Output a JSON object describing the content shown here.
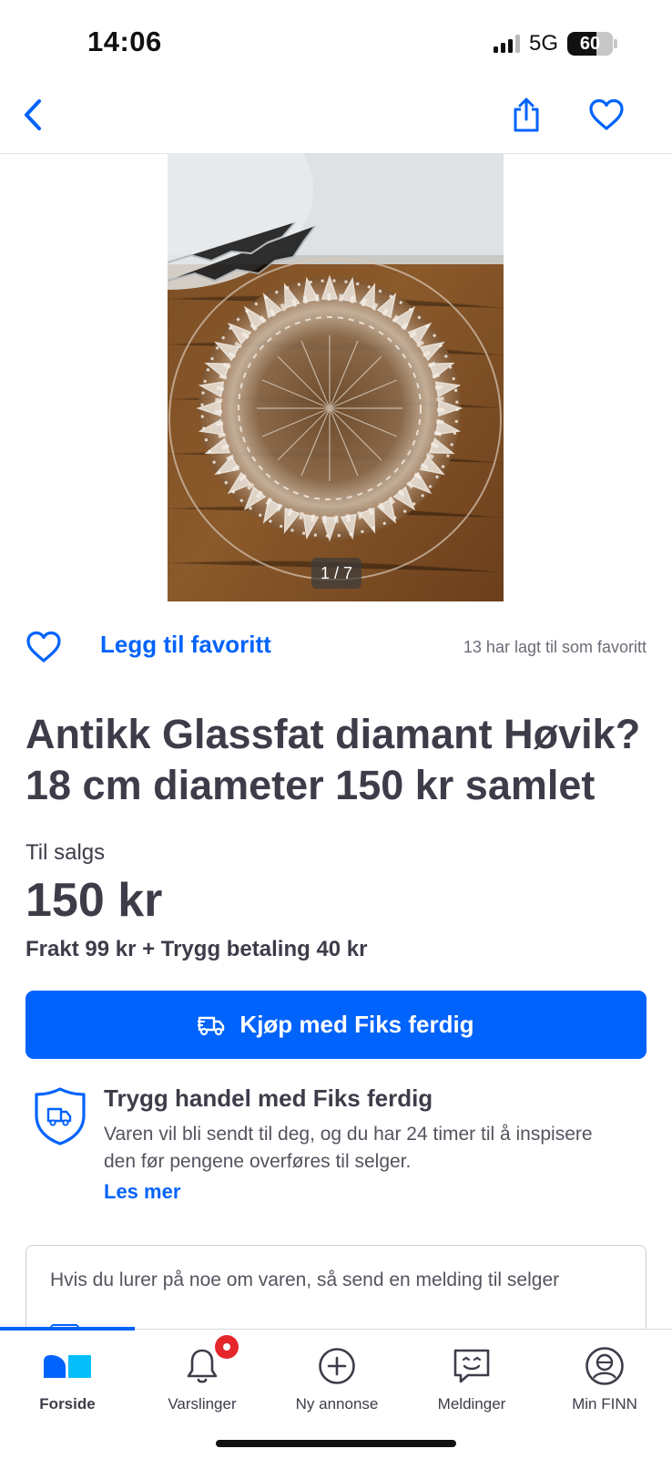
{
  "status": {
    "time": "14:06",
    "network": "5G",
    "battery": "60"
  },
  "listing": {
    "image_counter": "1 / 7",
    "favorite_label": "Legg til favoritt",
    "favorite_count": "13 har lagt til som favoritt",
    "title": "Antikk Glassfat diamant Høvik? 18 cm diameter 150 kr samlet",
    "sale_type": "Til salgs",
    "price": "150 kr",
    "shipping": "Frakt 99 kr + Trygg betaling 40 kr",
    "buy_button": "Kjøp med Fiks ferdig"
  },
  "trust": {
    "title": "Trygg handel med Fiks ferdig",
    "text": "Varen vil bli sendt til deg, og du har 24 timer til å inspisere den før pengene overføres til selger.",
    "link": "Les mer"
  },
  "message_box": {
    "text": "Hvis du lurer på noe om varen, så send en melding til selger"
  },
  "tabbar": {
    "items": [
      {
        "label": "Forside",
        "icon": "finn-logo-icon"
      },
      {
        "label": "Varslinger",
        "icon": "bell-icon"
      },
      {
        "label": "Ny annonse",
        "icon": "plus-circle-icon"
      },
      {
        "label": "Meldinger",
        "icon": "chat-icon"
      },
      {
        "label": "Min FINN",
        "icon": "profile-icon"
      }
    ]
  },
  "colors": {
    "accent": "#0063fb",
    "text": "#3d3d4a",
    "badge": "#e5262b"
  }
}
